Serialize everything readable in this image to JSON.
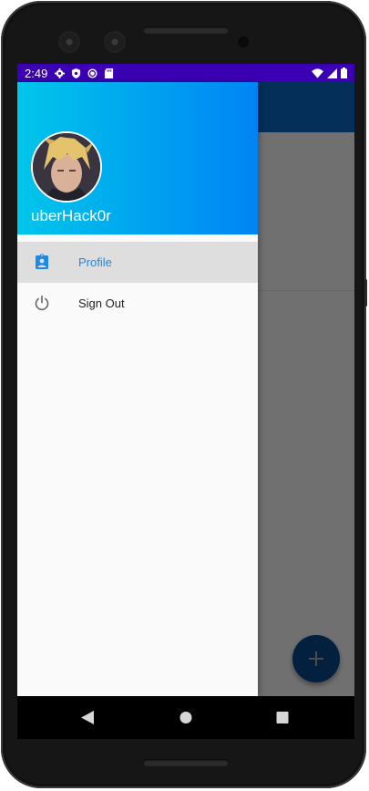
{
  "status_bar": {
    "time": "2:49",
    "left_icons": [
      "gear-icon",
      "shield-icon",
      "sync-icon",
      "sd-card-icon"
    ],
    "right_icons": [
      "wifi-icon",
      "signal-icon",
      "battery-icon"
    ],
    "color": "#3b00b3"
  },
  "drawer": {
    "header_gradient": [
      "#00c6ea",
      "#0084f4"
    ],
    "username": "uberHack0r",
    "items": [
      {
        "label": "Profile",
        "icon": "profile-badge-icon",
        "selected": true,
        "color": "#1e88e5"
      },
      {
        "label": "Sign Out",
        "icon": "power-icon",
        "selected": false,
        "color": "#222222"
      }
    ]
  },
  "app": {
    "app_bar_color": "#0a66c2",
    "fab_icon": "plus-icon"
  },
  "nav_bar": {
    "buttons": [
      "back-icon",
      "home-icon",
      "recents-icon"
    ]
  }
}
